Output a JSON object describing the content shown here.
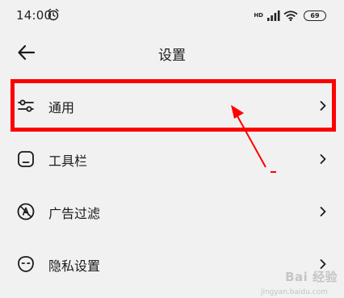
{
  "status_bar": {
    "time": "14:00",
    "network_label": "HD",
    "battery": "69",
    "icons": [
      "alarm-icon",
      "signal-icon",
      "wifi-icon",
      "battery-icon"
    ]
  },
  "header": {
    "title": "设置",
    "back_icon": "arrow-left-icon"
  },
  "settings_items": [
    {
      "label": "通用",
      "icon": "sliders-icon"
    },
    {
      "label": "工具栏",
      "icon": "toolbar-icon"
    },
    {
      "label": "广告过滤",
      "icon": "ad-block-icon"
    },
    {
      "label": "隐私设置",
      "icon": "privacy-mask-icon"
    }
  ],
  "annotation": {
    "highlight_color": "#ff0000",
    "highlighted_item": "通用"
  },
  "watermark": {
    "text": "Bai 经验",
    "sub": "jingyan.baidu.com"
  }
}
